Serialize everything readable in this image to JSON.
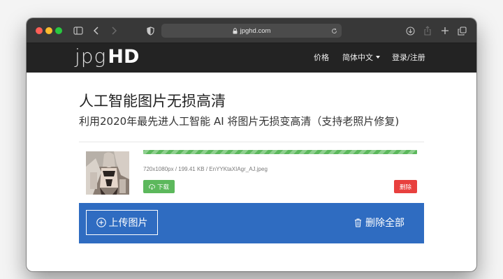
{
  "browser": {
    "url": "jpghd.com",
    "icons": [
      "sidebar-icon",
      "back-icon",
      "forward-icon",
      "shield-icon",
      "lock-icon",
      "reload-icon",
      "download-icon",
      "share-icon",
      "new-tab-icon",
      "tabs-icon"
    ]
  },
  "nav": {
    "logo_thin": "jpg",
    "logo_bold": "HD",
    "items": [
      {
        "label": "价格"
      },
      {
        "label": "简体中文"
      },
      {
        "label": "登录/注册"
      }
    ]
  },
  "main": {
    "title": "人工智能图片无损高清",
    "subtitle": "利用2020年最先进人工智能 AI 将图片无损变高清（支持老照片修复)"
  },
  "file": {
    "meta": "720x1080px / 199.41 KB / EnYYKtaXIAgr_AJ.jpeg",
    "progress": 1.0,
    "download_label": "下载",
    "delete_label": "删除"
  },
  "actions": {
    "upload_label": "上传图片",
    "delete_all_label": "删除全部"
  },
  "colors": {
    "nav_bg": "#232323",
    "progress": "#5cb85c",
    "download": "#5cb85c",
    "delete": "#e8403e",
    "upload_bar": "#2f6cc1"
  }
}
